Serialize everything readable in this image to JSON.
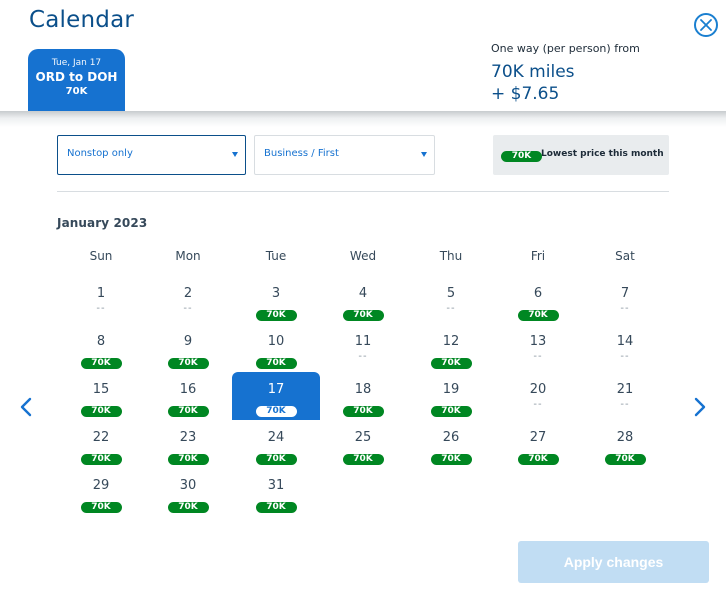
{
  "header": {
    "title": "Calendar",
    "close_icon": "close-circle-icon",
    "flight_tab": {
      "date": "Tue, Jan 17",
      "route": "ORD to DOH",
      "price": "70K"
    },
    "fare": {
      "label": "One way (per person) from",
      "miles": "70K miles",
      "cash": "+ $7.65"
    }
  },
  "filters": {
    "stops": {
      "value": "Nonstop only"
    },
    "cabin": {
      "value": "Business / First"
    }
  },
  "legend": {
    "pill": "70K",
    "text": "Lowest price this month",
    "pill_color": "#008722"
  },
  "calendar": {
    "month_label": "January 2023",
    "weekdays": [
      "Sun",
      "Mon",
      "Tue",
      "Wed",
      "Thu",
      "Fri",
      "Sat"
    ],
    "selected_day": 17,
    "empty_marker": "--",
    "days": [
      {
        "d": "1",
        "p": null
      },
      {
        "d": "2",
        "p": null
      },
      {
        "d": "3",
        "p": "70K"
      },
      {
        "d": "4",
        "p": "70K"
      },
      {
        "d": "5",
        "p": null
      },
      {
        "d": "6",
        "p": "70K"
      },
      {
        "d": "7",
        "p": null
      },
      {
        "d": "8",
        "p": "70K"
      },
      {
        "d": "9",
        "p": "70K"
      },
      {
        "d": "10",
        "p": "70K"
      },
      {
        "d": "11",
        "p": null
      },
      {
        "d": "12",
        "p": "70K"
      },
      {
        "d": "13",
        "p": null
      },
      {
        "d": "14",
        "p": null
      },
      {
        "d": "15",
        "p": "70K"
      },
      {
        "d": "16",
        "p": "70K"
      },
      {
        "d": "17",
        "p": "70K"
      },
      {
        "d": "18",
        "p": "70K"
      },
      {
        "d": "19",
        "p": "70K"
      },
      {
        "d": "20",
        "p": null
      },
      {
        "d": "21",
        "p": null
      },
      {
        "d": "22",
        "p": "70K"
      },
      {
        "d": "23",
        "p": "70K"
      },
      {
        "d": "24",
        "p": "70K"
      },
      {
        "d": "25",
        "p": "70K"
      },
      {
        "d": "26",
        "p": "70K"
      },
      {
        "d": "27",
        "p": "70K"
      },
      {
        "d": "28",
        "p": "70K"
      },
      {
        "d": "29",
        "p": "70K"
      },
      {
        "d": "30",
        "p": "70K"
      },
      {
        "d": "31",
        "p": "70K"
      }
    ],
    "prev_icon": "chevron-left-icon",
    "next_icon": "chevron-right-icon"
  },
  "actions": {
    "apply_label": "Apply changes"
  },
  "colors": {
    "accent": "#1672d0",
    "title": "#0b4f8a",
    "price_pill": "#008722",
    "apply_disabled": "#c1ddf3"
  }
}
